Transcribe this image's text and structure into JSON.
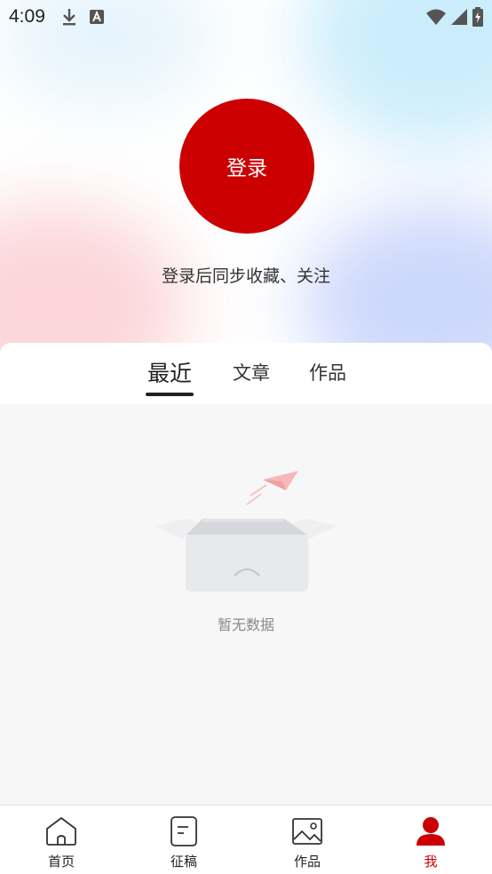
{
  "status_bar": {
    "time": "4:09",
    "icons_left": [
      "download-icon",
      "font-a-icon"
    ],
    "icons_right": [
      "wifi-icon",
      "signal-icon",
      "battery-icon"
    ]
  },
  "profile": {
    "login_label": "登录",
    "hint": "登录后同步收藏、关注"
  },
  "tabs": [
    {
      "label": "最近",
      "active": true
    },
    {
      "label": "文章",
      "active": false
    },
    {
      "label": "作品",
      "active": false
    }
  ],
  "empty_state": {
    "text": "暂无数据",
    "icon": "empty-box-icon"
  },
  "bottom_nav": [
    {
      "label": "首页",
      "icon": "home-icon",
      "active": false
    },
    {
      "label": "征稿",
      "icon": "document-icon",
      "active": false
    },
    {
      "label": "作品",
      "icon": "image-icon",
      "active": false
    },
    {
      "label": "我",
      "icon": "user-icon",
      "active": true
    }
  ],
  "colors": {
    "accent": "#cc0000",
    "background": "#f7f7f7",
    "text": "#333333"
  }
}
